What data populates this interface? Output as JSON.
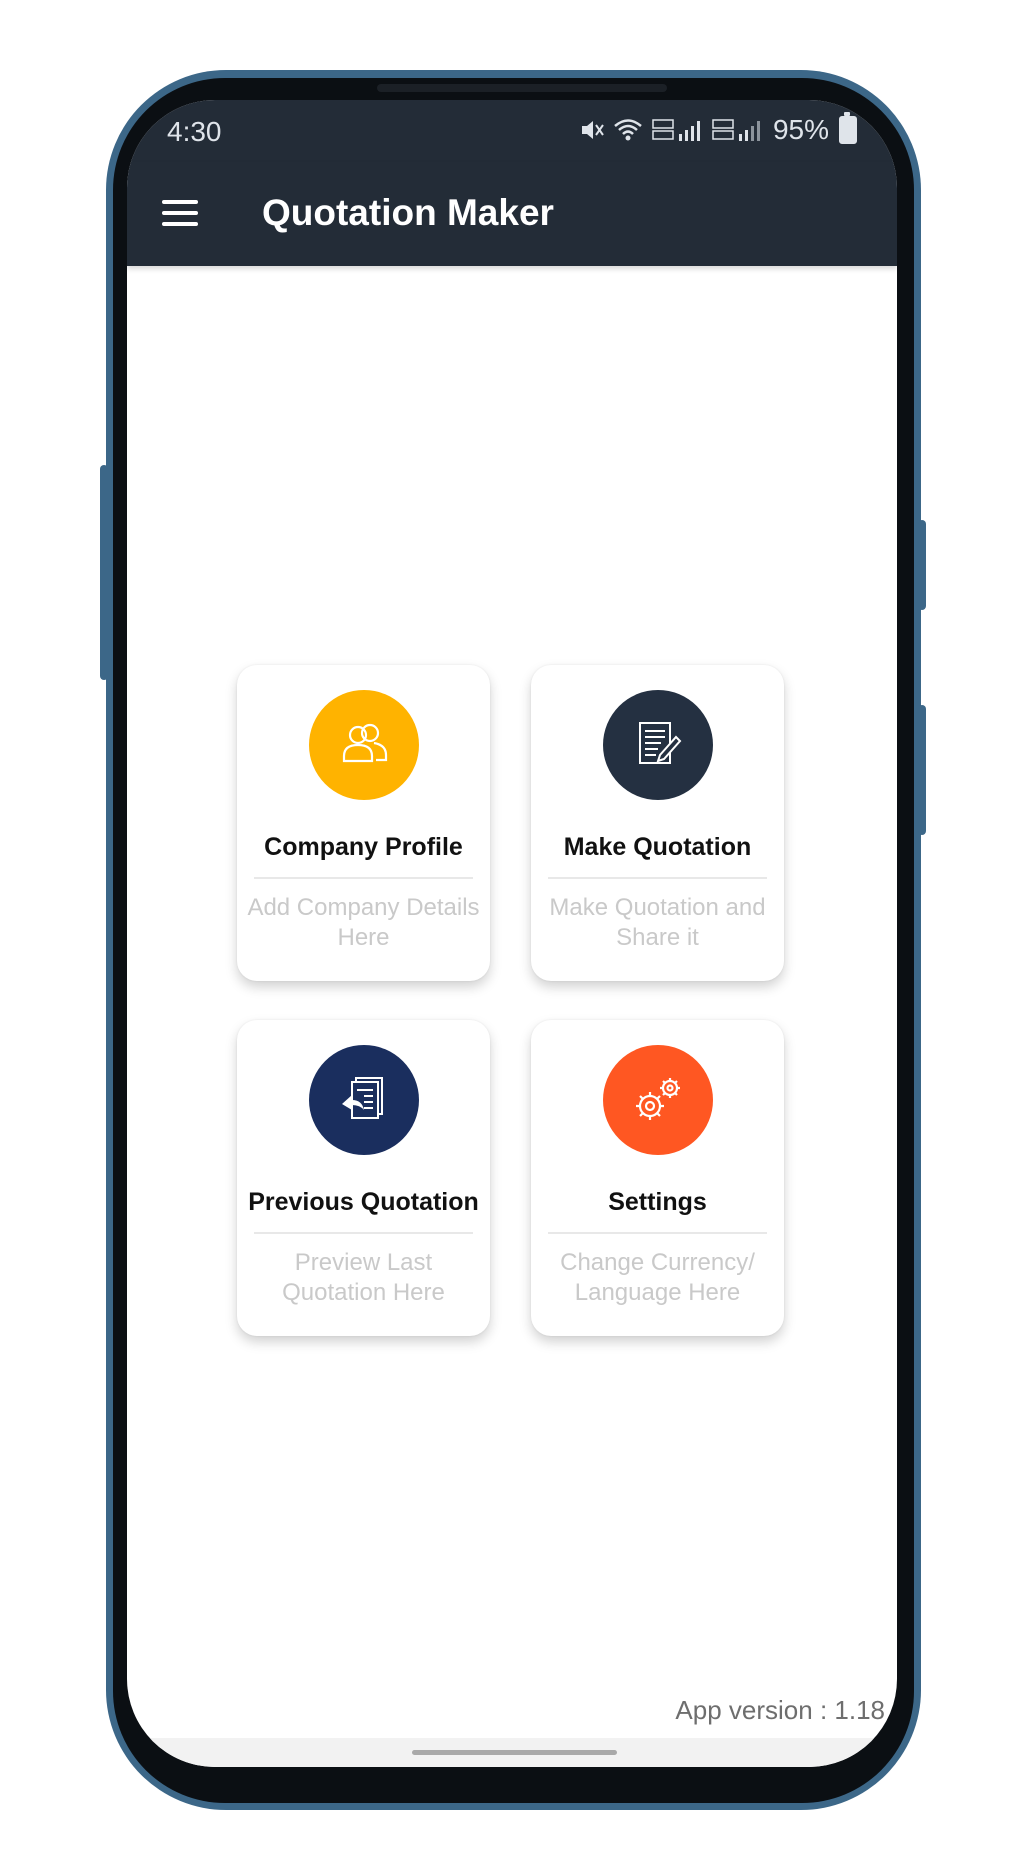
{
  "status_bar": {
    "time": "4:30",
    "battery_percent": "95%",
    "icons": [
      "mute-icon",
      "wifi-icon",
      "volte-lte1-signal-icon",
      "volte-lte2-signal-icon",
      "battery-icon"
    ]
  },
  "toolbar": {
    "title": "Quotation Maker"
  },
  "cards": [
    {
      "title": "Company Profile",
      "description": "Add Company Details Here",
      "icon": "users-icon",
      "color": "#FFB300"
    },
    {
      "title": "Make Quotation",
      "description": "Make Quotation and Share it",
      "icon": "document-edit-icon",
      "color": "#243041"
    },
    {
      "title": "Previous Quotation",
      "description": "Preview Last Quotation Here",
      "icon": "document-back-icon",
      "color": "#1A2E5E"
    },
    {
      "title": "Settings",
      "description": "Change Currency/ Language Here",
      "icon": "gears-icon",
      "color": "#FF5722"
    }
  ],
  "footer": {
    "app_version": "App version : 1.18"
  }
}
